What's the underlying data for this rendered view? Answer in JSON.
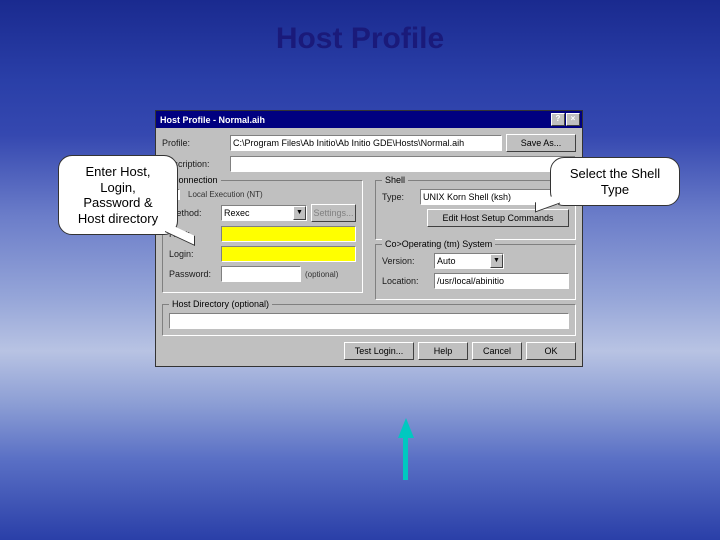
{
  "title": "Host Profile",
  "callouts": {
    "left": "Enter Host, Login, Password & Host directory",
    "right": "Select the Shell Type"
  },
  "dialog": {
    "title": "Host Profile - Normal.aih",
    "profile_label": "Profile:",
    "profile_value": "C:\\Program Files\\Ab Initio\\Ab Initio GDE\\Hosts\\Normal.aih",
    "saveas": "Save As...",
    "description_label": "Description:",
    "description_value": "",
    "connection_legend": "Connection",
    "local_exec": "Local Execution (NT)",
    "method_label": "Method:",
    "method_value": "Rexec",
    "settings": "Settings...",
    "host_label": "Host:",
    "host_value": "",
    "login_label": "Login:",
    "login_value": "",
    "password_label": "Password:",
    "password_value": "",
    "password_hint": "(optional)",
    "shell_legend": "Shell",
    "type_label": "Type:",
    "type_value": "UNIX Korn Shell (ksh)",
    "edit_host_setup": "Edit Host Setup Commands",
    "coop_legend": "Co>Operating (tm) System",
    "version_label": "Version:",
    "version_value": "Auto",
    "location_label": "Location:",
    "location_value": "/usr/local/abinitio",
    "hostdir_legend": "Host Directory (optional)",
    "hostdir_value": "",
    "buttons": {
      "test": "Test Login...",
      "help": "Help",
      "cancel": "Cancel",
      "ok": "OK"
    }
  }
}
